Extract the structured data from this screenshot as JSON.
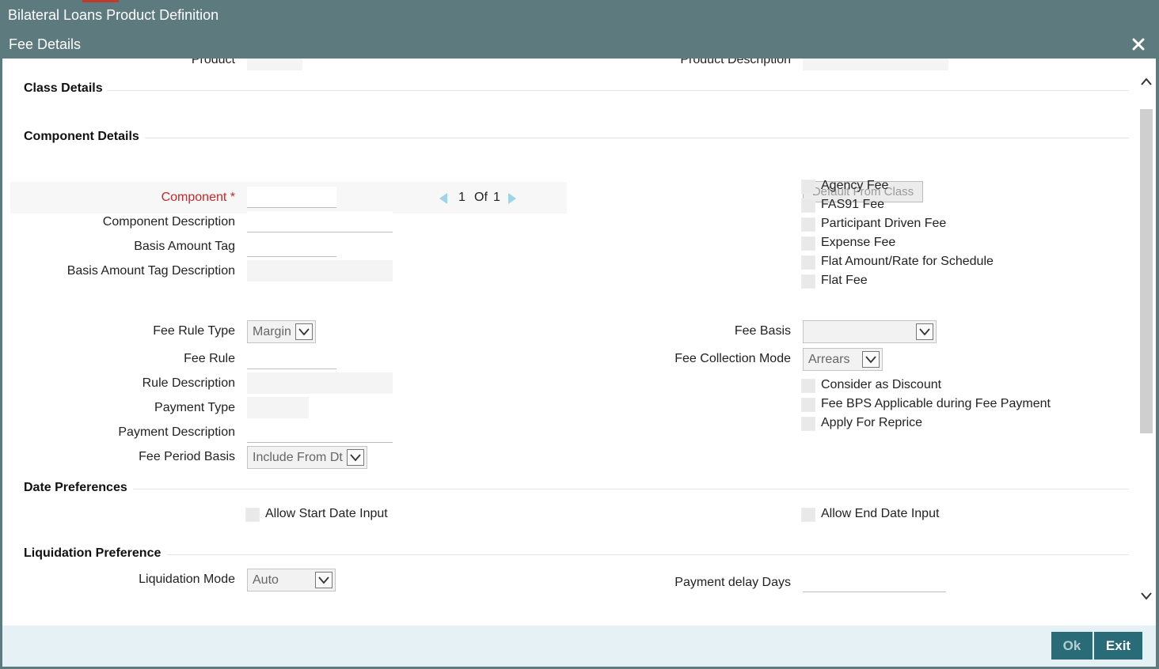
{
  "window": {
    "title": "Bilateral Loans Product Definition"
  },
  "dialog": {
    "title": "Fee Details",
    "close_icon": "close-icon"
  },
  "header": {
    "product_label": "Product",
    "product_value": "",
    "product_desc_label": "Product Description",
    "product_desc_value": ""
  },
  "sections": {
    "class_details": "Class Details",
    "component_details": "Component Details",
    "date_preferences": "Date Preferences",
    "liquidation_preference": "Liquidation Preference"
  },
  "pager": {
    "current": "1",
    "of_label": "Of",
    "total": "1"
  },
  "component": {
    "component_label": "Component",
    "required_mark": "*",
    "component_value": "",
    "component_desc_label": "Component Description",
    "component_desc_value": "",
    "basis_amount_tag_label": "Basis Amount Tag",
    "basis_amount_tag_value": "",
    "basis_amount_tag_desc_label": "Basis Amount Tag Description",
    "basis_amount_tag_desc_value": ""
  },
  "default_from_class_button": "Default From Class",
  "flags": [
    {
      "label": "Agency Fee",
      "checked": false
    },
    {
      "label": "FAS91 Fee",
      "checked": false
    },
    {
      "label": "Participant Driven Fee",
      "checked": false
    },
    {
      "label": "Expense Fee",
      "checked": false
    },
    {
      "label": "Flat Amount/Rate for Schedule",
      "checked": false
    },
    {
      "label": "Flat Fee",
      "checked": false
    }
  ],
  "fee_rule": {
    "fee_rule_type_label": "Fee Rule Type",
    "fee_rule_type_value": "Margin",
    "fee_rule_label": "Fee Rule",
    "fee_rule_value": "",
    "rule_description_label": "Rule Description",
    "rule_description_value": "",
    "payment_type_label": "Payment Type",
    "payment_type_value": "",
    "payment_description_label": "Payment Description",
    "payment_description_value": "",
    "fee_period_basis_label": "Fee Period Basis",
    "fee_period_basis_value": "Include From Dt"
  },
  "fee_basis": {
    "fee_basis_label": "Fee Basis",
    "fee_basis_value": "",
    "fee_collection_mode_label": "Fee Collection Mode",
    "fee_collection_mode_value": "Arrears"
  },
  "fee_options": [
    {
      "label": "Consider as Discount",
      "checked": false
    },
    {
      "label": "Fee BPS Applicable during Fee Payment",
      "checked": false
    },
    {
      "label": "Apply For Reprice",
      "checked": false
    }
  ],
  "date_preferences": {
    "allow_start_date_input": "Allow Start Date Input",
    "allow_end_date_input": "Allow End Date Input"
  },
  "liquidation": {
    "liquidation_mode_label": "Liquidation Mode",
    "liquidation_mode_value": "Auto",
    "payment_delay_days_label": "Payment delay Days",
    "payment_delay_days_value": ""
  },
  "footer": {
    "ok_label": "Ok",
    "exit_label": "Exit"
  },
  "colors": {
    "title_bar": "#5d7b7e",
    "button": "#2a6b78",
    "required": "#c62828",
    "footer": "#e5f1f4"
  }
}
